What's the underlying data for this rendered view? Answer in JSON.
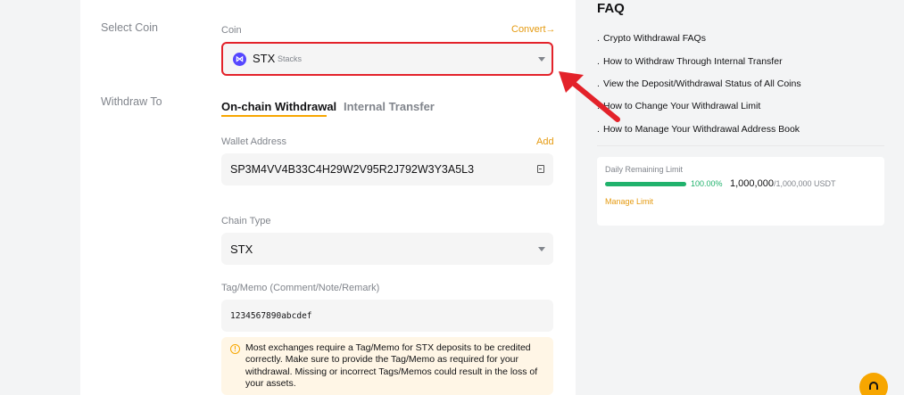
{
  "form": {
    "select_coin_label": "Select Coin",
    "withdraw_to_label": "Withdraw To",
    "coin": {
      "label": "Coin",
      "convert_link": "Convert",
      "convert_arrow": "→",
      "icon_glyph": "⋈",
      "symbol": "STX",
      "name": "Stacks"
    },
    "tabs": [
      {
        "label": "On-chain Withdrawal",
        "active": true
      },
      {
        "label": "Internal Transfer",
        "active": false
      }
    ],
    "wallet": {
      "label": "Wallet Address",
      "add_link": "Add",
      "value": "SP3M4VV4B33C4H29W2V95R2J792W3Y3A5L3"
    },
    "chain": {
      "label": "Chain Type",
      "value": "STX"
    },
    "memo": {
      "label": "Tag/Memo (Comment/Note/Remark)",
      "value": "1234567890abcdef"
    },
    "notice": {
      "icon_glyph": "!",
      "text": "Most exchanges require a Tag/Memo for STX deposits to be credited correctly. Make sure to provide the Tag/Memo as required for your withdrawal. Missing or incorrect Tags/Memos could result in the loss of your assets."
    }
  },
  "faq": {
    "title": "FAQ",
    "bullet": ".",
    "items": [
      "Crypto Withdrawal FAQs",
      "How to Withdraw Through Internal Transfer",
      "View the Deposit/Withdrawal Status of All Coins",
      "How to Change Your Withdrawal Limit",
      "How to Manage Your Withdrawal Address Book"
    ]
  },
  "limit": {
    "title": "Daily Remaining Limit",
    "percent_text": "100.00%",
    "percent_value": 1.0,
    "used": "1,000,000",
    "total": "/1,000,000 USDT",
    "manage_link": "Manage Limit"
  },
  "icons": {
    "coin": "stacks-coin-icon",
    "caret": "chevron-down-icon",
    "address_book": "address-book-icon",
    "warning": "warning-icon",
    "support": "headset-icon",
    "annotation": "red-arrow-annotation"
  },
  "colors": {
    "accent": "#f7a600",
    "highlight_border": "#e3222a",
    "success": "#20b26c",
    "coin_brand": "#5546ff"
  }
}
